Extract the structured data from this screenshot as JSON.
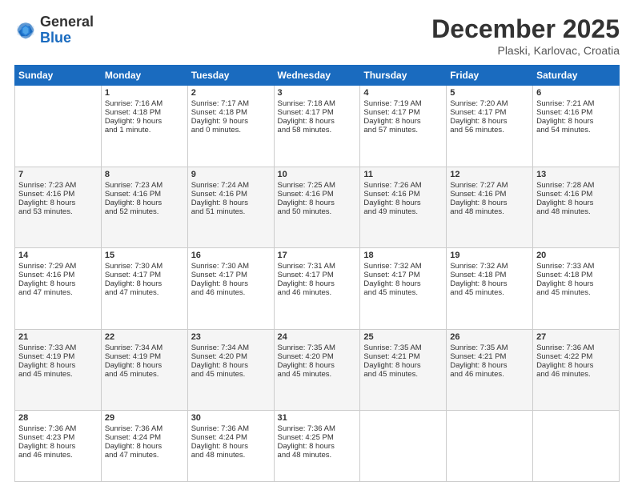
{
  "header": {
    "logo_general": "General",
    "logo_blue": "Blue",
    "month_title": "December 2025",
    "location": "Plaski, Karlovac, Croatia"
  },
  "days_of_week": [
    "Sunday",
    "Monday",
    "Tuesday",
    "Wednesday",
    "Thursday",
    "Friday",
    "Saturday"
  ],
  "weeks": [
    [
      {
        "day": "",
        "lines": []
      },
      {
        "day": "1",
        "lines": [
          "Sunrise: 7:16 AM",
          "Sunset: 4:18 PM",
          "Daylight: 9 hours",
          "and 1 minute."
        ]
      },
      {
        "day": "2",
        "lines": [
          "Sunrise: 7:17 AM",
          "Sunset: 4:18 PM",
          "Daylight: 9 hours",
          "and 0 minutes."
        ]
      },
      {
        "day": "3",
        "lines": [
          "Sunrise: 7:18 AM",
          "Sunset: 4:17 PM",
          "Daylight: 8 hours",
          "and 58 minutes."
        ]
      },
      {
        "day": "4",
        "lines": [
          "Sunrise: 7:19 AM",
          "Sunset: 4:17 PM",
          "Daylight: 8 hours",
          "and 57 minutes."
        ]
      },
      {
        "day": "5",
        "lines": [
          "Sunrise: 7:20 AM",
          "Sunset: 4:17 PM",
          "Daylight: 8 hours",
          "and 56 minutes."
        ]
      },
      {
        "day": "6",
        "lines": [
          "Sunrise: 7:21 AM",
          "Sunset: 4:16 PM",
          "Daylight: 8 hours",
          "and 54 minutes."
        ]
      }
    ],
    [
      {
        "day": "7",
        "lines": [
          "Sunrise: 7:23 AM",
          "Sunset: 4:16 PM",
          "Daylight: 8 hours",
          "and 53 minutes."
        ]
      },
      {
        "day": "8",
        "lines": [
          "Sunrise: 7:23 AM",
          "Sunset: 4:16 PM",
          "Daylight: 8 hours",
          "and 52 minutes."
        ]
      },
      {
        "day": "9",
        "lines": [
          "Sunrise: 7:24 AM",
          "Sunset: 4:16 PM",
          "Daylight: 8 hours",
          "and 51 minutes."
        ]
      },
      {
        "day": "10",
        "lines": [
          "Sunrise: 7:25 AM",
          "Sunset: 4:16 PM",
          "Daylight: 8 hours",
          "and 50 minutes."
        ]
      },
      {
        "day": "11",
        "lines": [
          "Sunrise: 7:26 AM",
          "Sunset: 4:16 PM",
          "Daylight: 8 hours",
          "and 49 minutes."
        ]
      },
      {
        "day": "12",
        "lines": [
          "Sunrise: 7:27 AM",
          "Sunset: 4:16 PM",
          "Daylight: 8 hours",
          "and 48 minutes."
        ]
      },
      {
        "day": "13",
        "lines": [
          "Sunrise: 7:28 AM",
          "Sunset: 4:16 PM",
          "Daylight: 8 hours",
          "and 48 minutes."
        ]
      }
    ],
    [
      {
        "day": "14",
        "lines": [
          "Sunrise: 7:29 AM",
          "Sunset: 4:16 PM",
          "Daylight: 8 hours",
          "and 47 minutes."
        ]
      },
      {
        "day": "15",
        "lines": [
          "Sunrise: 7:30 AM",
          "Sunset: 4:17 PM",
          "Daylight: 8 hours",
          "and 47 minutes."
        ]
      },
      {
        "day": "16",
        "lines": [
          "Sunrise: 7:30 AM",
          "Sunset: 4:17 PM",
          "Daylight: 8 hours",
          "and 46 minutes."
        ]
      },
      {
        "day": "17",
        "lines": [
          "Sunrise: 7:31 AM",
          "Sunset: 4:17 PM",
          "Daylight: 8 hours",
          "and 46 minutes."
        ]
      },
      {
        "day": "18",
        "lines": [
          "Sunrise: 7:32 AM",
          "Sunset: 4:17 PM",
          "Daylight: 8 hours",
          "and 45 minutes."
        ]
      },
      {
        "day": "19",
        "lines": [
          "Sunrise: 7:32 AM",
          "Sunset: 4:18 PM",
          "Daylight: 8 hours",
          "and 45 minutes."
        ]
      },
      {
        "day": "20",
        "lines": [
          "Sunrise: 7:33 AM",
          "Sunset: 4:18 PM",
          "Daylight: 8 hours",
          "and 45 minutes."
        ]
      }
    ],
    [
      {
        "day": "21",
        "lines": [
          "Sunrise: 7:33 AM",
          "Sunset: 4:19 PM",
          "Daylight: 8 hours",
          "and 45 minutes."
        ]
      },
      {
        "day": "22",
        "lines": [
          "Sunrise: 7:34 AM",
          "Sunset: 4:19 PM",
          "Daylight: 8 hours",
          "and 45 minutes."
        ]
      },
      {
        "day": "23",
        "lines": [
          "Sunrise: 7:34 AM",
          "Sunset: 4:20 PM",
          "Daylight: 8 hours",
          "and 45 minutes."
        ]
      },
      {
        "day": "24",
        "lines": [
          "Sunrise: 7:35 AM",
          "Sunset: 4:20 PM",
          "Daylight: 8 hours",
          "and 45 minutes."
        ]
      },
      {
        "day": "25",
        "lines": [
          "Sunrise: 7:35 AM",
          "Sunset: 4:21 PM",
          "Daylight: 8 hours",
          "and 45 minutes."
        ]
      },
      {
        "day": "26",
        "lines": [
          "Sunrise: 7:35 AM",
          "Sunset: 4:21 PM",
          "Daylight: 8 hours",
          "and 46 minutes."
        ]
      },
      {
        "day": "27",
        "lines": [
          "Sunrise: 7:36 AM",
          "Sunset: 4:22 PM",
          "Daylight: 8 hours",
          "and 46 minutes."
        ]
      }
    ],
    [
      {
        "day": "28",
        "lines": [
          "Sunrise: 7:36 AM",
          "Sunset: 4:23 PM",
          "Daylight: 8 hours",
          "and 46 minutes."
        ]
      },
      {
        "day": "29",
        "lines": [
          "Sunrise: 7:36 AM",
          "Sunset: 4:24 PM",
          "Daylight: 8 hours",
          "and 47 minutes."
        ]
      },
      {
        "day": "30",
        "lines": [
          "Sunrise: 7:36 AM",
          "Sunset: 4:24 PM",
          "Daylight: 8 hours",
          "and 48 minutes."
        ]
      },
      {
        "day": "31",
        "lines": [
          "Sunrise: 7:36 AM",
          "Sunset: 4:25 PM",
          "Daylight: 8 hours",
          "and 48 minutes."
        ]
      },
      {
        "day": "",
        "lines": []
      },
      {
        "day": "",
        "lines": []
      },
      {
        "day": "",
        "lines": []
      }
    ]
  ]
}
